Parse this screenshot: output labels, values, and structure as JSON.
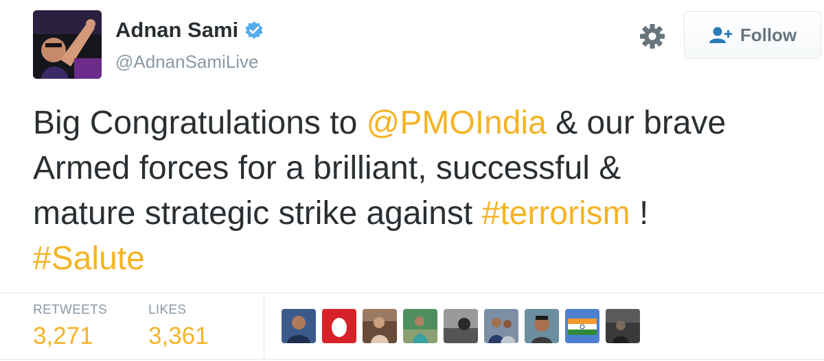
{
  "user": {
    "display_name": "Adnan Sami",
    "handle": "@AdnanSamiLive",
    "verified_icon": "verified-badge-icon",
    "avatar_icon": "profile-photo"
  },
  "actions": {
    "settings_icon": "gear-icon",
    "follow_icon": "add-user-icon",
    "follow_label": "Follow"
  },
  "tweet": {
    "line1_pre": "Big Congratulations to ",
    "mention": "@PMOIndia",
    "line1_post": " & our brave",
    "line2": "Armed forces for a brilliant, successful &",
    "line3_pre": "mature strategic strike against ",
    "hashtag1": "#terrorism",
    "line3_post": " !",
    "hashtag2": "#Salute"
  },
  "stats": {
    "retweets_label": "RETWEETS",
    "retweets_value": "3,271",
    "likes_label": "LIKES",
    "likes_value": "3,361"
  },
  "likers": [
    {
      "icon": "liker-avatar-portrait",
      "bg": "#3a5a8c"
    },
    {
      "icon": "liker-avatar-egg",
      "bg": "#d8222a"
    },
    {
      "icon": "liker-avatar-sepia",
      "bg": "#7a5a45"
    },
    {
      "icon": "liker-avatar-outdoor",
      "bg": "#5a9a6e"
    },
    {
      "icon": "liker-avatar-mono",
      "bg": "#8a8a8a"
    },
    {
      "icon": "liker-avatar-crowd",
      "bg": "#6d7f95"
    },
    {
      "icon": "liker-avatar-face",
      "bg": "#6b8fa0"
    },
    {
      "icon": "liker-avatar-flag",
      "bg": "#4d7fcf"
    },
    {
      "icon": "liker-avatar-dark",
      "bg": "#4a4a4a"
    }
  ],
  "colors": {
    "accent": "#f5b324",
    "text": "#292f33",
    "muted": "#8899a6",
    "verified": "#55acee"
  }
}
